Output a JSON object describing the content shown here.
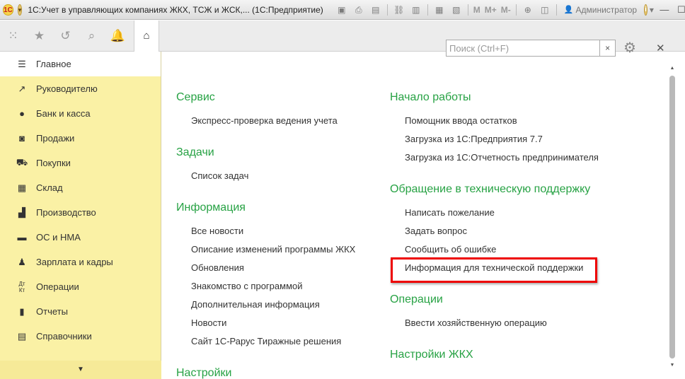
{
  "window": {
    "logo": "1С",
    "title": "1С:Учет в управляющих компаниях ЖКХ, ТСЖ и ЖСК,...  (1С:Предприятие)",
    "m_label": "M",
    "mplus_label": "M+",
    "mminus_label": "M-",
    "user": "Администратор"
  },
  "sidebar": {
    "items": [
      {
        "label": "Главное",
        "icon": "menu-icon"
      },
      {
        "label": "Руководителю",
        "icon": "trend-icon"
      },
      {
        "label": "Банк и касса",
        "icon": "coin-icon"
      },
      {
        "label": "Продажи",
        "icon": "bag-icon"
      },
      {
        "label": "Покупки",
        "icon": "cart-icon"
      },
      {
        "label": "Склад",
        "icon": "warehouse-icon"
      },
      {
        "label": "Производство",
        "icon": "factory-icon"
      },
      {
        "label": "ОС и НМА",
        "icon": "assets-icon"
      },
      {
        "label": "Зарплата и кадры",
        "icon": "person-icon"
      },
      {
        "label": "Операции",
        "icon": "dt-kt-icon"
      },
      {
        "label": "Отчеты",
        "icon": "chart-icon"
      },
      {
        "label": "Справочники",
        "icon": "book-icon"
      }
    ]
  },
  "search": {
    "placeholder": "Поиск (Ctrl+F)",
    "clear": "×"
  },
  "left_groups": {
    "service": {
      "title": "Сервис",
      "links": [
        "Экспресс-проверка ведения учета"
      ]
    },
    "tasks": {
      "title": "Задачи",
      "links": [
        "Список задач"
      ]
    },
    "info": {
      "title": "Информация",
      "links": [
        "Все новости",
        "Описание изменений программы ЖКХ",
        "Обновления",
        "Знакомство с программой",
        "Дополнительная информация",
        "Новости",
        "Сайт 1С-Рарус Тиражные решения"
      ]
    },
    "settings": {
      "title": "Настройки"
    }
  },
  "right_groups": {
    "start": {
      "title": "Начало работы",
      "links": [
        "Помощник ввода остатков",
        "Загрузка из 1С:Предприятия 7.7",
        "Загрузка из 1С:Отчетность предпринимателя"
      ]
    },
    "support": {
      "title": "Обращение в техническую поддержку",
      "links": [
        "Написать пожелание",
        "Задать вопрос",
        "Сообщить об ошибке",
        "Информация для технической поддержки"
      ]
    },
    "operations": {
      "title": "Операции",
      "links": [
        "Ввести хозяйственную операцию"
      ]
    },
    "zhkh": {
      "title": "Настройки ЖКХ"
    }
  },
  "colors": {
    "accent_green": "#27a244",
    "sidebar_bg": "#faf1a5",
    "highlight": "#e00000"
  }
}
